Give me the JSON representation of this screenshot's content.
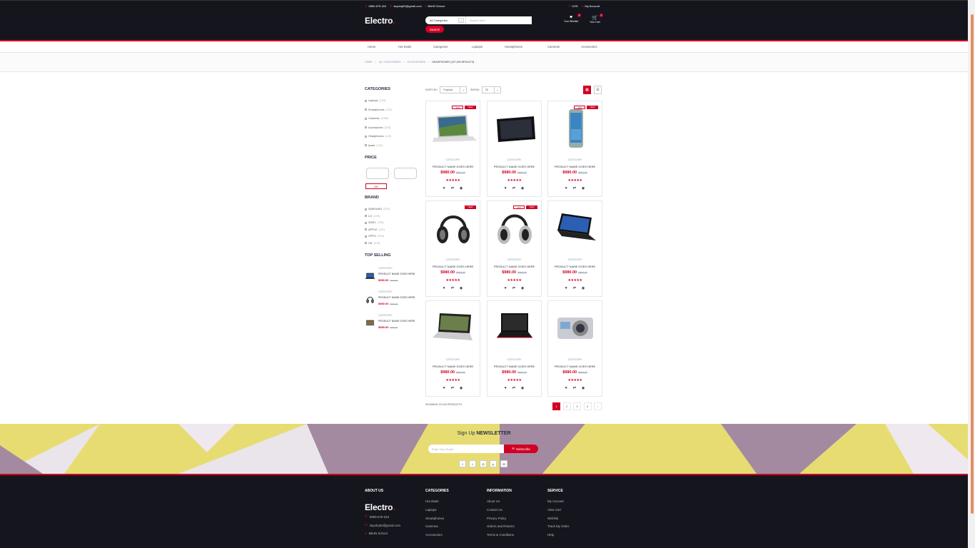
{
  "topbar": {
    "phone": "0869-679-324",
    "email": "skyahq03@gmail.com",
    "school": "BkHN School",
    "currency": "USD",
    "account": "My Account"
  },
  "logo": {
    "text": "Electro",
    "dot": "."
  },
  "search": {
    "category": "All Categories",
    "placeholder": "Search here",
    "button": "Search"
  },
  "header_icons": {
    "wishlist_label": "Your Wishlist",
    "wishlist_qty": "2",
    "cart_label": "Your Cart",
    "cart_qty": "3"
  },
  "nav": [
    "Home",
    "Hot Deals",
    "Categories",
    "Laptops",
    "Smartphones",
    "Cameras",
    "Accessories"
  ],
  "breadcrumb": [
    "HOME",
    "ALL CATEGORIES",
    "ACCESSORIES",
    "HEADPHONES (227,490 RESULTS)"
  ],
  "aside": {
    "categories_title": "Categories",
    "categories": [
      {
        "name": "Laptops",
        "count": "(120)"
      },
      {
        "name": "Smartphones",
        "count": "(740)"
      },
      {
        "name": "Cameras",
        "count": "(1450)"
      },
      {
        "name": "Accessories",
        "count": "(578)"
      },
      {
        "name": "Headphones",
        "count": "(120)"
      },
      {
        "name": "Ipads",
        "count": "(740)"
      }
    ],
    "price_title": "Price",
    "price_ok": "OK",
    "brand_title": "Brand",
    "brands": [
      {
        "name": "SAMSUNG",
        "count": "(578)"
      },
      {
        "name": "LG",
        "count": "(125)"
      },
      {
        "name": "SONY",
        "count": "(755)"
      },
      {
        "name": "APPLE",
        "count": "(321)"
      },
      {
        "name": "OPPO",
        "count": "(578)"
      },
      {
        "name": "HD",
        "count": "(578)"
      }
    ],
    "top_selling_title": "Top selling",
    "top_selling": [
      {
        "category": "CATEGORY",
        "name": "PRODUCT NAME GOES HERE",
        "price": "$980.00",
        "old": "$990.00",
        "img": "laptop-dark"
      },
      {
        "category": "CATEGORY",
        "name": "PRODUCT NAME GOES HERE",
        "price": "$980.00",
        "old": "$990.00",
        "img": "headphones"
      },
      {
        "category": "CATEGORY",
        "name": "PRODUCT NAME GOES HERE",
        "price": "$980.00",
        "old": "$990.00",
        "img": "laptop-light"
      }
    ]
  },
  "store_filter": {
    "sort_label": "SORT BY:",
    "sort_value": "Popular",
    "show_label": "SHOW:",
    "show_value": "20"
  },
  "products": [
    {
      "category": "CATEGORY",
      "name": "PRODUCT NAME GOES HERE",
      "price": "$980.00",
      "old": "$990.00",
      "sale": "-30%",
      "new": "NEW",
      "img": "laptop-silver"
    },
    {
      "category": "CATEGORY",
      "name": "PRODUCT NAME GOES HERE",
      "price": "$980.00",
      "old": "$990.00",
      "sale": "",
      "new": "",
      "img": "tablet"
    },
    {
      "category": "CATEGORY",
      "name": "PRODUCT NAME GOES HERE",
      "price": "$980.00",
      "old": "$990.00",
      "sale": "-30%",
      "new": "NEW",
      "img": "phone"
    },
    {
      "category": "CATEGORY",
      "name": "PRODUCT NAME GOES HERE",
      "price": "$980.00",
      "old": "$990.00",
      "sale": "",
      "new": "NEW",
      "img": "headphones"
    },
    {
      "category": "CATEGORY",
      "name": "PRODUCT NAME GOES HERE",
      "price": "$980.00",
      "old": "$990.00",
      "sale": "-30%",
      "new": "NEW",
      "img": "headphones-silver"
    },
    {
      "category": "CATEGORY",
      "name": "PRODUCT NAME GOES HERE",
      "price": "$980.00",
      "old": "$990.00",
      "sale": "",
      "new": "",
      "img": "laptop-blue"
    },
    {
      "category": "CATEGORY",
      "name": "PRODUCT NAME GOES HERE",
      "price": "$980.00",
      "old": "$990.00",
      "sale": "",
      "new": "",
      "img": "laptop-silver2"
    },
    {
      "category": "CATEGORY",
      "name": "PRODUCT NAME GOES HERE",
      "price": "$980.00",
      "old": "$990.00",
      "sale": "",
      "new": "",
      "img": "laptop-black"
    },
    {
      "category": "CATEGORY",
      "name": "PRODUCT NAME GOES HERE",
      "price": "$980.00",
      "old": "$990.00",
      "sale": "",
      "new": "",
      "img": "camera"
    }
  ],
  "rating_stars": "★★★★★",
  "showing": "SHOWING 20-100 PRODUCTS",
  "pagination": [
    "1",
    "2",
    "3",
    "4"
  ],
  "newsletter": {
    "title_pre": "Sign Up",
    "title_bold": "NEWSLETTER",
    "placeholder": "Enter Your Email",
    "button": "Subscribe"
  },
  "socials": [
    "facebook-icon",
    "twitter-icon",
    "instagram-icon",
    "pinterest-icon",
    "email-icon"
  ],
  "footer": {
    "about_title": "About Us",
    "logo": "Electro",
    "phone": "0869-679-324",
    "email": "skyahq03@gmail.com",
    "address": "BkHN School",
    "categories_title": "Categories",
    "categories": [
      "Hot deals",
      "Laptops",
      "Smartphones",
      "Cameras",
      "Accessories"
    ],
    "information_title": "Information",
    "information": [
      "About Us",
      "Contact Us",
      "Privacy Policy",
      "Orders and Returns",
      "Terms & Conditions"
    ],
    "service_title": "Service",
    "service": [
      "My Account",
      "View Cart",
      "Wishlist",
      "Track My Order",
      "Help"
    ]
  },
  "colors": {
    "accent": "#D10024",
    "dark": "#15161D"
  }
}
